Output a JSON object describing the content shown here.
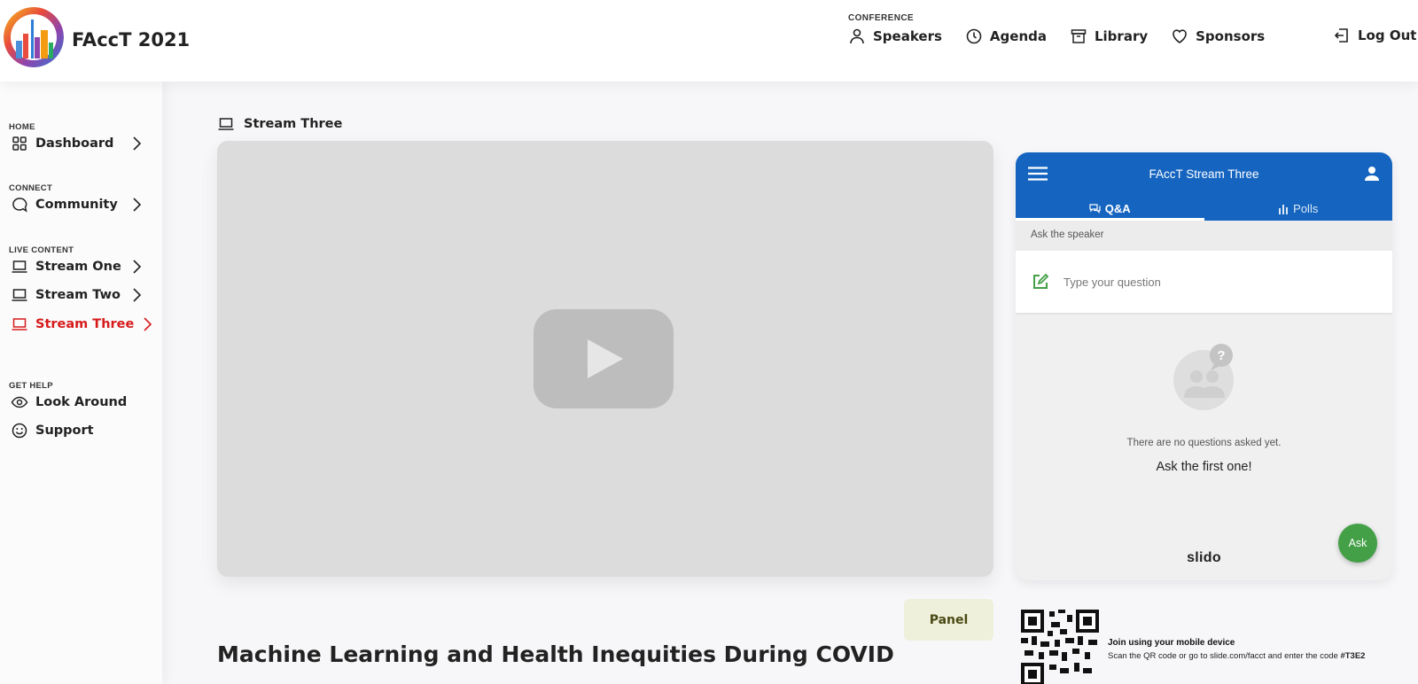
{
  "header": {
    "brand": "FAccT 2021",
    "conference_label": "CONFERENCE",
    "nav": [
      {
        "label": "Speakers",
        "icon": "person-icon"
      },
      {
        "label": "Agenda",
        "icon": "clock-icon"
      },
      {
        "label": "Library",
        "icon": "archive-icon"
      },
      {
        "label": "Sponsors",
        "icon": "heart-icon"
      }
    ],
    "logout_label": "Log Out"
  },
  "sidebar": {
    "sections": {
      "home": "HOME",
      "connect": "CONNECT",
      "live": "LIVE CONTENT",
      "help": "GET HELP"
    },
    "items": {
      "dashboard": "Dashboard",
      "community": "Community",
      "stream_one": "Stream One",
      "stream_two": "Stream Two",
      "stream_three": "Stream Three",
      "look_around": "Look Around",
      "support": "Support"
    },
    "active_item": "Stream Three",
    "active_color": "#d71a1a"
  },
  "main": {
    "stream_title": "Stream Three",
    "panel_label": "Panel",
    "talk_title": "Machine Learning and Health Inequities During COVID"
  },
  "slido": {
    "title": "FAccT Stream Three",
    "tabs": [
      {
        "label": "Q&A",
        "icon": "chat-icon"
      },
      {
        "label": "Polls",
        "icon": "bar-chart-icon"
      }
    ],
    "ask_speaker_label": "Ask the speaker",
    "question_placeholder": "Type your question",
    "empty_text": "There are no questions asked yet.",
    "empty_cta": "Ask the first one!",
    "ask_button": "Ask",
    "logo_text": "slido",
    "brand_color": "#1565c0",
    "join_title": "Join using your mobile device",
    "join_text_prefix": "Scan the QR code or go to slide.com/facct and enter the code ",
    "join_code": "#T3E2"
  }
}
